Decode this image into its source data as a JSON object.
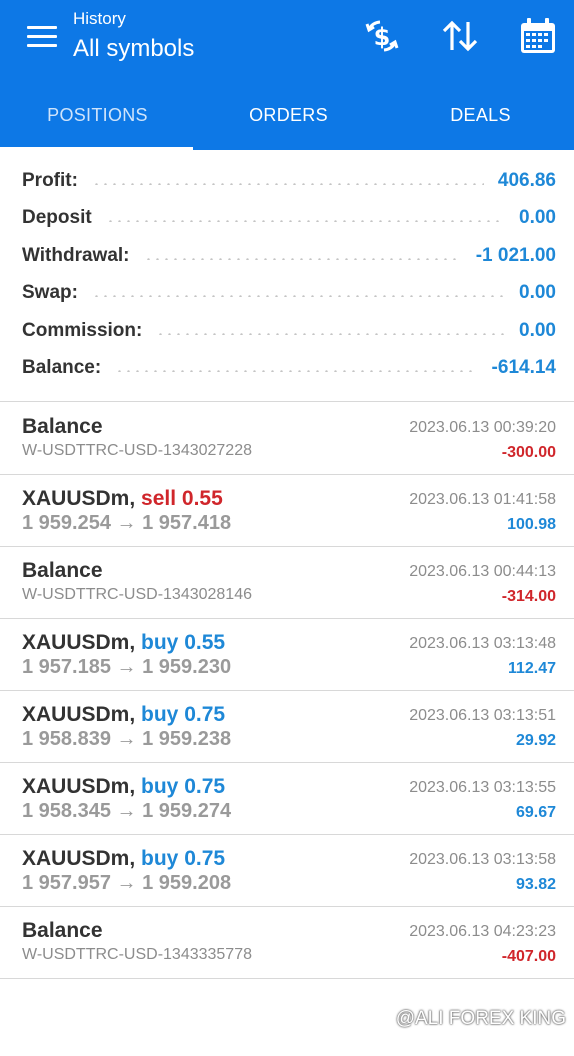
{
  "header": {
    "subtitle": "History",
    "title": "All symbols",
    "icons": [
      "currency-exchange-icon",
      "sort-icon",
      "calendar-icon"
    ],
    "bg_color": "#0d78e6"
  },
  "tabs": [
    {
      "label": "POSITIONS",
      "active": true
    },
    {
      "label": "ORDERS",
      "active": false
    },
    {
      "label": "DEALS",
      "active": false
    }
  ],
  "summary": [
    {
      "label": "Profit:",
      "value": "406.86"
    },
    {
      "label": "Deposit",
      "value": "0.00"
    },
    {
      "label": "Withdrawal:",
      "value": "-1 021.00"
    },
    {
      "label": "Swap:",
      "value": "0.00"
    },
    {
      "label": "Commission:",
      "value": "0.00"
    },
    {
      "label": "Balance:",
      "value": "-614.14"
    }
  ],
  "deals": [
    {
      "type": "balance",
      "title": "Balance",
      "comment": "W-USDTTRC-USD-1343027228",
      "time": "2023.06.13 00:39:20",
      "amount": "-300.00"
    },
    {
      "type": "trade",
      "symbol": "XAUUSDm,",
      "side": "sell 0.55",
      "prices": "1 959.254 → 1 957.418",
      "time": "2023.06.13 01:41:58",
      "amount": "100.98"
    },
    {
      "type": "balance",
      "title": "Balance",
      "comment": "W-USDTTRC-USD-1343028146",
      "time": "2023.06.13 00:44:13",
      "amount": "-314.00"
    },
    {
      "type": "trade",
      "symbol": "XAUUSDm,",
      "side": "buy 0.55",
      "prices": "1 957.185 → 1 959.230",
      "time": "2023.06.13 03:13:48",
      "amount": "112.47"
    },
    {
      "type": "trade",
      "symbol": "XAUUSDm,",
      "side": "buy 0.75",
      "prices": "1 958.839 → 1 959.238",
      "time": "2023.06.13 03:13:51",
      "amount": "29.92"
    },
    {
      "type": "trade",
      "symbol": "XAUUSDm,",
      "side": "buy 0.75",
      "prices": "1 958.345 → 1 959.274",
      "time": "2023.06.13 03:13:55",
      "amount": "69.67"
    },
    {
      "type": "trade",
      "symbol": "XAUUSDm,",
      "side": "buy 0.75",
      "prices": "1 957.957 → 1 959.208",
      "time": "2023.06.13 03:13:58",
      "amount": "93.82"
    },
    {
      "type": "balance",
      "title": "Balance",
      "comment": "W-USDTTRC-USD-1343335778",
      "time": "2023.06.13 04:23:23",
      "amount": "-407.00"
    }
  ],
  "colors": {
    "positive": "#1e88d7",
    "negative": "#d0262b"
  },
  "watermark": "@ALI FOREX KING"
}
